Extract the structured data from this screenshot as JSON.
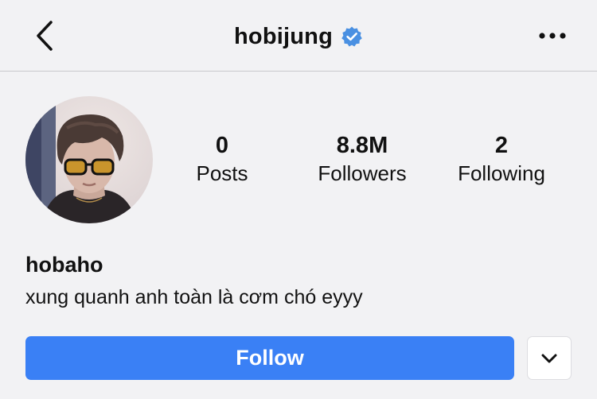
{
  "header": {
    "title": "hobijung",
    "back_icon": "chevron-left-icon",
    "verified_icon": "verified-badge-icon",
    "more_icon": "ellipsis-icon"
  },
  "profile": {
    "avatar": "profile-photo",
    "stats": [
      {
        "value": "0",
        "label": "Posts"
      },
      {
        "value": "8.8M",
        "label": "Followers"
      },
      {
        "value": "2",
        "label": "Following"
      }
    ],
    "name": "hobaho",
    "bio": "xung quanh anh toàn là cơm chó eyyy"
  },
  "actions": {
    "follow_label": "Follow",
    "dropdown_icon": "chevron-down-icon"
  },
  "colors": {
    "background": "#f2f2f4",
    "accent": "#3a80f5",
    "verified": "#4a90e2"
  }
}
